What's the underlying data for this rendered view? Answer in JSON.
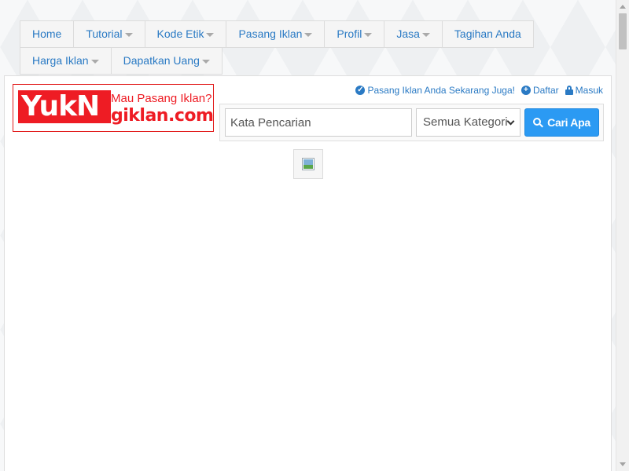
{
  "nav": {
    "items": [
      {
        "label": "Home",
        "dropdown": false
      },
      {
        "label": "Tutorial",
        "dropdown": true
      },
      {
        "label": "Kode Etik",
        "dropdown": true
      },
      {
        "label": "Pasang Iklan",
        "dropdown": true
      },
      {
        "label": "Profil",
        "dropdown": true
      },
      {
        "label": "Jasa",
        "dropdown": true
      },
      {
        "label": "Tagihan Anda",
        "dropdown": false
      },
      {
        "label": "Harga Iklan",
        "dropdown": true
      },
      {
        "label": "Dapatkan Uang",
        "dropdown": true
      }
    ]
  },
  "logo": {
    "brand_part1": "YukN",
    "tagline": "Mau Pasang Iklan?",
    "brand_part2": "giklan.com"
  },
  "toplinks": {
    "promo": "Pasang Iklan Anda Sekarang Juga!",
    "register": "Daftar",
    "login": "Masuk"
  },
  "search": {
    "placeholder": "Kata Pencarian",
    "category_selected": "Semua Kategori",
    "button_label": "Cari Apa"
  },
  "colors": {
    "link": "#2a7ac4",
    "brand_red": "#ee1c24",
    "button_blue": "#2b9af3"
  }
}
